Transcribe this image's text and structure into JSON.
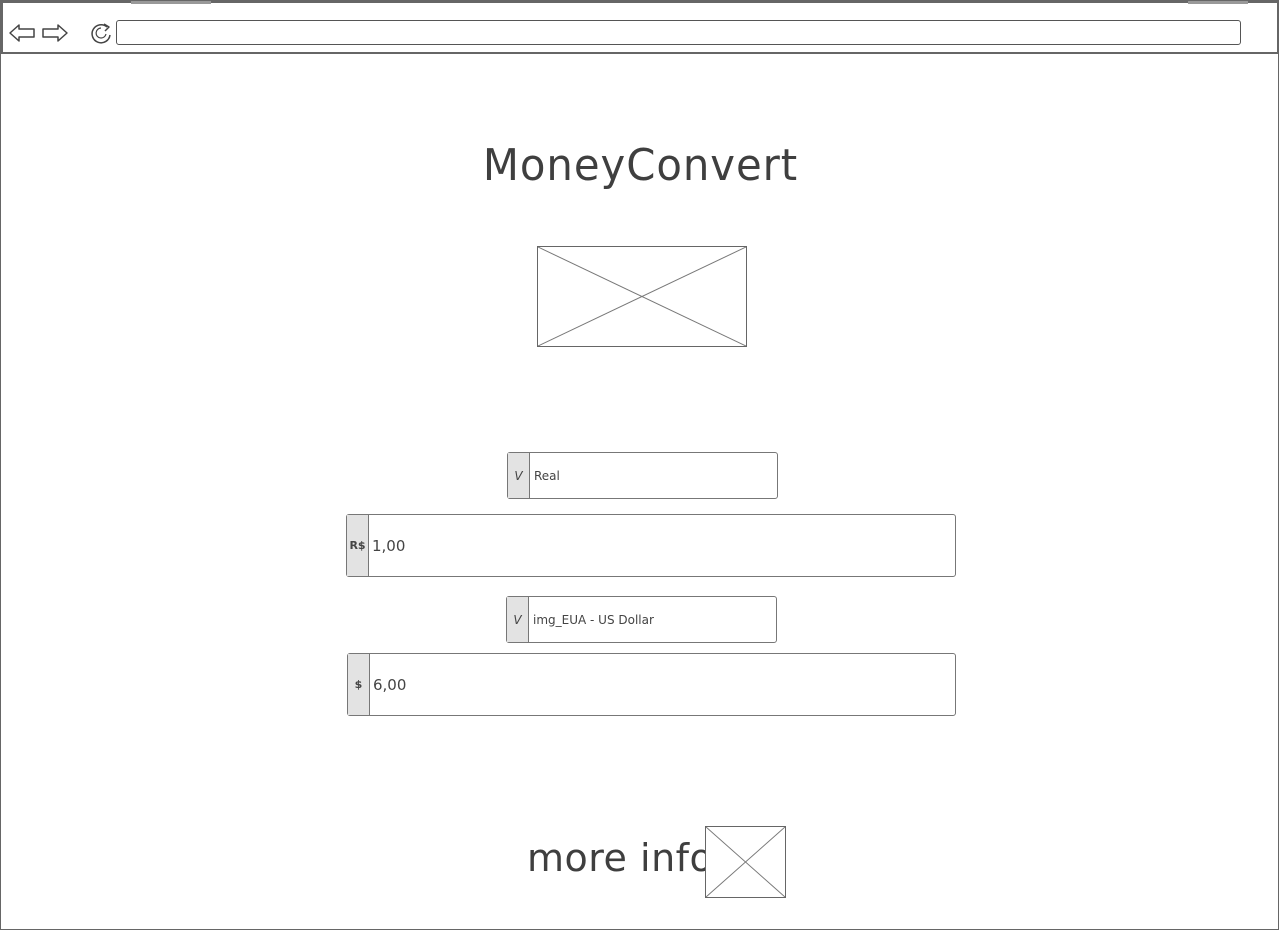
{
  "app": {
    "title": "MoneyConvert"
  },
  "browser": {
    "address": "",
    "icons": [
      "back-arrow-icon",
      "forward-arrow-icon",
      "reload-icon"
    ]
  },
  "converter": {
    "from": {
      "dropdown_arrow": "V",
      "currency": "Real",
      "symbol": "R$",
      "amount": "1,00"
    },
    "to": {
      "dropdown_arrow": "V",
      "currency": "img_EUA - US Dollar",
      "symbol": "$",
      "amount": "6,00"
    }
  },
  "footer": {
    "more_info_label": "more info"
  },
  "colors": {
    "stroke": "#666666",
    "fill_gray": "#e3e3e3",
    "text": "#444444"
  }
}
